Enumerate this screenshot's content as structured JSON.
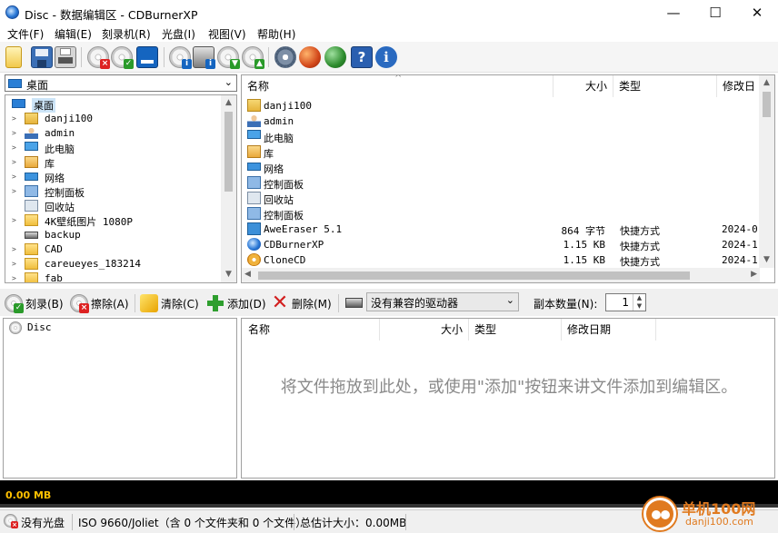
{
  "window": {
    "title": "Disc - 数据编辑区 - CDBurnerXP",
    "minimize": "—",
    "maximize": "☐",
    "close": "✕"
  },
  "menu": [
    "文件(F)",
    "编辑(E)",
    "刻录机(R)",
    "光盘(I)",
    "视图(V)",
    "帮助(H)"
  ],
  "toolbar_icons": [
    "new-icon",
    "save-icon",
    "print-icon",
    "erase-disc-icon",
    "finalize-disc-icon",
    "disc-info-icon",
    "drive-info-icon",
    "eject-icon",
    "load-icon",
    "burn-icon",
    "settings-icon",
    "refresh-icon",
    "update-icon",
    "help-icon",
    "info-icon"
  ],
  "left_panel": {
    "location": "桌面",
    "tree": [
      {
        "label": "桌面",
        "level": 0,
        "expander": "",
        "icon": "desktop-icon",
        "selected": true
      },
      {
        "label": "danji100",
        "level": 1,
        "expander": ">",
        "icon": "user-folder-icon"
      },
      {
        "label": "admin",
        "level": 1,
        "expander": ">",
        "icon": "user-icon"
      },
      {
        "label": "此电脑",
        "level": 1,
        "expander": ">",
        "icon": "computer-icon"
      },
      {
        "label": "库",
        "level": 1,
        "expander": ">",
        "icon": "library-icon"
      },
      {
        "label": "网络",
        "level": 1,
        "expander": ">",
        "icon": "network-icon"
      },
      {
        "label": "控制面板",
        "level": 1,
        "expander": ">",
        "icon": "control-panel-icon"
      },
      {
        "label": "回收站",
        "level": 1,
        "expander": "",
        "icon": "recycle-bin-icon"
      },
      {
        "label": "4K壁纸图片 1080P",
        "level": 1,
        "expander": ">",
        "icon": "folder-icon"
      },
      {
        "label": "backup",
        "level": 1,
        "expander": "",
        "icon": "drive-folder-icon"
      },
      {
        "label": "CAD",
        "level": 1,
        "expander": ">",
        "icon": "folder-icon"
      },
      {
        "label": "careueyes_183214",
        "level": 1,
        "expander": ">",
        "icon": "folder-icon"
      },
      {
        "label": "fab",
        "level": 1,
        "expander": ">",
        "icon": "folder-icon"
      }
    ]
  },
  "file_list": {
    "columns": {
      "name": "名称",
      "size": "大小",
      "type": "类型",
      "modified": "修改日"
    },
    "rows": [
      {
        "name": "danji100",
        "size": "",
        "type": "",
        "modified": "",
        "icon": "user-folder-icon"
      },
      {
        "name": "admin",
        "size": "",
        "type": "",
        "modified": "",
        "icon": "user-icon"
      },
      {
        "name": "此电脑",
        "size": "",
        "type": "",
        "modified": "",
        "icon": "computer-icon"
      },
      {
        "name": "库",
        "size": "",
        "type": "",
        "modified": "",
        "icon": "library-icon"
      },
      {
        "name": "网络",
        "size": "",
        "type": "",
        "modified": "",
        "icon": "network-icon"
      },
      {
        "name": "控制面板",
        "size": "",
        "type": "",
        "modified": "",
        "icon": "control-panel-icon"
      },
      {
        "name": "回收站",
        "size": "",
        "type": "",
        "modified": "",
        "icon": "recycle-bin-icon"
      },
      {
        "name": "控制面板",
        "size": "",
        "type": "",
        "modified": "",
        "icon": "control-panel-icon"
      },
      {
        "name": "AweEraser 5.1",
        "size": "864 字节",
        "type": "快捷方式",
        "modified": "2024-0",
        "icon": "shortcut-icon"
      },
      {
        "name": "CDBurnerXP",
        "size": "1.15 KB",
        "type": "快捷方式",
        "modified": "2024-1",
        "icon": "cdburner-icon"
      },
      {
        "name": "CloneCD",
        "size": "1.15 KB",
        "type": "快捷方式",
        "modified": "2024-1",
        "icon": "clonecd-icon"
      }
    ]
  },
  "burn_toolbar": {
    "burn": "刻录(B)",
    "erase": "擦除(A)",
    "clear": "清除(C)",
    "add": "添加(D)",
    "delete": "删除(M)",
    "drive": "没有兼容的驱动器",
    "copies_label": "副本数量(N):",
    "copies_value": "1"
  },
  "compile": {
    "root": "Disc",
    "columns": {
      "name": "名称",
      "size": "大小",
      "type": "类型",
      "modified": "修改日期"
    },
    "empty_message": "将文件拖放到此处，或使用\"添加\"按钮来讲文件添加到编辑区。"
  },
  "capacity": {
    "used": "0.00 MB"
  },
  "status": {
    "disc": "没有光盘",
    "format": "ISO 9660/Joliet（含 0 个文件夹和 0 个文件）",
    "total": "总估计大小：0.00MB"
  },
  "watermark": {
    "text": "单机100网",
    "url": "danji100.com"
  },
  "colors": {
    "accent": "#0066cc",
    "capacity_text": "#ffc000",
    "watermark": "#e07a1f"
  }
}
